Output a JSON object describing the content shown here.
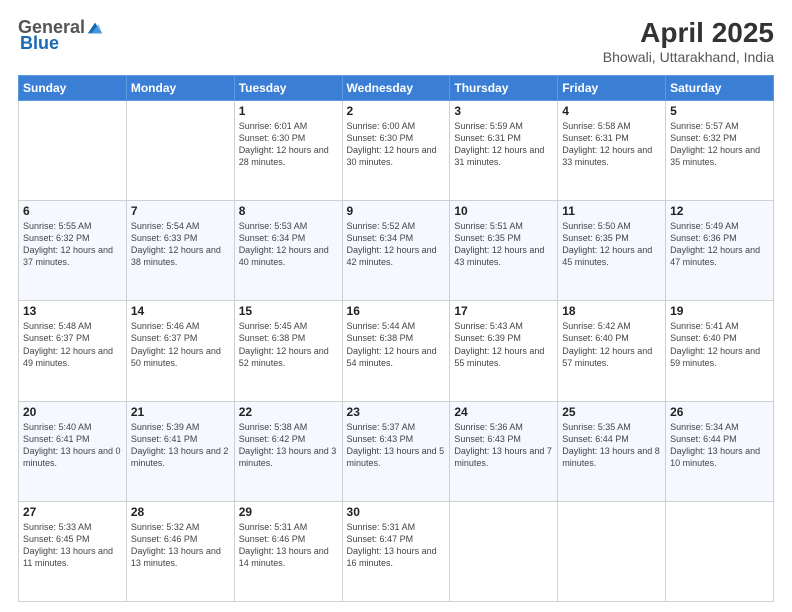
{
  "header": {
    "logo_general": "General",
    "logo_blue": "Blue",
    "month_title": "April 2025",
    "subtitle": "Bhowali, Uttarakhand, India"
  },
  "days_of_week": [
    "Sunday",
    "Monday",
    "Tuesday",
    "Wednesday",
    "Thursday",
    "Friday",
    "Saturday"
  ],
  "weeks": [
    [
      {
        "day": "",
        "sunrise": "",
        "sunset": "",
        "daylight": ""
      },
      {
        "day": "",
        "sunrise": "",
        "sunset": "",
        "daylight": ""
      },
      {
        "day": "1",
        "sunrise": "Sunrise: 6:01 AM",
        "sunset": "Sunset: 6:30 PM",
        "daylight": "Daylight: 12 hours and 28 minutes."
      },
      {
        "day": "2",
        "sunrise": "Sunrise: 6:00 AM",
        "sunset": "Sunset: 6:30 PM",
        "daylight": "Daylight: 12 hours and 30 minutes."
      },
      {
        "day": "3",
        "sunrise": "Sunrise: 5:59 AM",
        "sunset": "Sunset: 6:31 PM",
        "daylight": "Daylight: 12 hours and 31 minutes."
      },
      {
        "day": "4",
        "sunrise": "Sunrise: 5:58 AM",
        "sunset": "Sunset: 6:31 PM",
        "daylight": "Daylight: 12 hours and 33 minutes."
      },
      {
        "day": "5",
        "sunrise": "Sunrise: 5:57 AM",
        "sunset": "Sunset: 6:32 PM",
        "daylight": "Daylight: 12 hours and 35 minutes."
      }
    ],
    [
      {
        "day": "6",
        "sunrise": "Sunrise: 5:55 AM",
        "sunset": "Sunset: 6:32 PM",
        "daylight": "Daylight: 12 hours and 37 minutes."
      },
      {
        "day": "7",
        "sunrise": "Sunrise: 5:54 AM",
        "sunset": "Sunset: 6:33 PM",
        "daylight": "Daylight: 12 hours and 38 minutes."
      },
      {
        "day": "8",
        "sunrise": "Sunrise: 5:53 AM",
        "sunset": "Sunset: 6:34 PM",
        "daylight": "Daylight: 12 hours and 40 minutes."
      },
      {
        "day": "9",
        "sunrise": "Sunrise: 5:52 AM",
        "sunset": "Sunset: 6:34 PM",
        "daylight": "Daylight: 12 hours and 42 minutes."
      },
      {
        "day": "10",
        "sunrise": "Sunrise: 5:51 AM",
        "sunset": "Sunset: 6:35 PM",
        "daylight": "Daylight: 12 hours and 43 minutes."
      },
      {
        "day": "11",
        "sunrise": "Sunrise: 5:50 AM",
        "sunset": "Sunset: 6:35 PM",
        "daylight": "Daylight: 12 hours and 45 minutes."
      },
      {
        "day": "12",
        "sunrise": "Sunrise: 5:49 AM",
        "sunset": "Sunset: 6:36 PM",
        "daylight": "Daylight: 12 hours and 47 minutes."
      }
    ],
    [
      {
        "day": "13",
        "sunrise": "Sunrise: 5:48 AM",
        "sunset": "Sunset: 6:37 PM",
        "daylight": "Daylight: 12 hours and 49 minutes."
      },
      {
        "day": "14",
        "sunrise": "Sunrise: 5:46 AM",
        "sunset": "Sunset: 6:37 PM",
        "daylight": "Daylight: 12 hours and 50 minutes."
      },
      {
        "day": "15",
        "sunrise": "Sunrise: 5:45 AM",
        "sunset": "Sunset: 6:38 PM",
        "daylight": "Daylight: 12 hours and 52 minutes."
      },
      {
        "day": "16",
        "sunrise": "Sunrise: 5:44 AM",
        "sunset": "Sunset: 6:38 PM",
        "daylight": "Daylight: 12 hours and 54 minutes."
      },
      {
        "day": "17",
        "sunrise": "Sunrise: 5:43 AM",
        "sunset": "Sunset: 6:39 PM",
        "daylight": "Daylight: 12 hours and 55 minutes."
      },
      {
        "day": "18",
        "sunrise": "Sunrise: 5:42 AM",
        "sunset": "Sunset: 6:40 PM",
        "daylight": "Daylight: 12 hours and 57 minutes."
      },
      {
        "day": "19",
        "sunrise": "Sunrise: 5:41 AM",
        "sunset": "Sunset: 6:40 PM",
        "daylight": "Daylight: 12 hours and 59 minutes."
      }
    ],
    [
      {
        "day": "20",
        "sunrise": "Sunrise: 5:40 AM",
        "sunset": "Sunset: 6:41 PM",
        "daylight": "Daylight: 13 hours and 0 minutes."
      },
      {
        "day": "21",
        "sunrise": "Sunrise: 5:39 AM",
        "sunset": "Sunset: 6:41 PM",
        "daylight": "Daylight: 13 hours and 2 minutes."
      },
      {
        "day": "22",
        "sunrise": "Sunrise: 5:38 AM",
        "sunset": "Sunset: 6:42 PM",
        "daylight": "Daylight: 13 hours and 3 minutes."
      },
      {
        "day": "23",
        "sunrise": "Sunrise: 5:37 AM",
        "sunset": "Sunset: 6:43 PM",
        "daylight": "Daylight: 13 hours and 5 minutes."
      },
      {
        "day": "24",
        "sunrise": "Sunrise: 5:36 AM",
        "sunset": "Sunset: 6:43 PM",
        "daylight": "Daylight: 13 hours and 7 minutes."
      },
      {
        "day": "25",
        "sunrise": "Sunrise: 5:35 AM",
        "sunset": "Sunset: 6:44 PM",
        "daylight": "Daylight: 13 hours and 8 minutes."
      },
      {
        "day": "26",
        "sunrise": "Sunrise: 5:34 AM",
        "sunset": "Sunset: 6:44 PM",
        "daylight": "Daylight: 13 hours and 10 minutes."
      }
    ],
    [
      {
        "day": "27",
        "sunrise": "Sunrise: 5:33 AM",
        "sunset": "Sunset: 6:45 PM",
        "daylight": "Daylight: 13 hours and 11 minutes."
      },
      {
        "day": "28",
        "sunrise": "Sunrise: 5:32 AM",
        "sunset": "Sunset: 6:46 PM",
        "daylight": "Daylight: 13 hours and 13 minutes."
      },
      {
        "day": "29",
        "sunrise": "Sunrise: 5:31 AM",
        "sunset": "Sunset: 6:46 PM",
        "daylight": "Daylight: 13 hours and 14 minutes."
      },
      {
        "day": "30",
        "sunrise": "Sunrise: 5:31 AM",
        "sunset": "Sunset: 6:47 PM",
        "daylight": "Daylight: 13 hours and 16 minutes."
      },
      {
        "day": "",
        "sunrise": "",
        "sunset": "",
        "daylight": ""
      },
      {
        "day": "",
        "sunrise": "",
        "sunset": "",
        "daylight": ""
      },
      {
        "day": "",
        "sunrise": "",
        "sunset": "",
        "daylight": ""
      }
    ]
  ]
}
